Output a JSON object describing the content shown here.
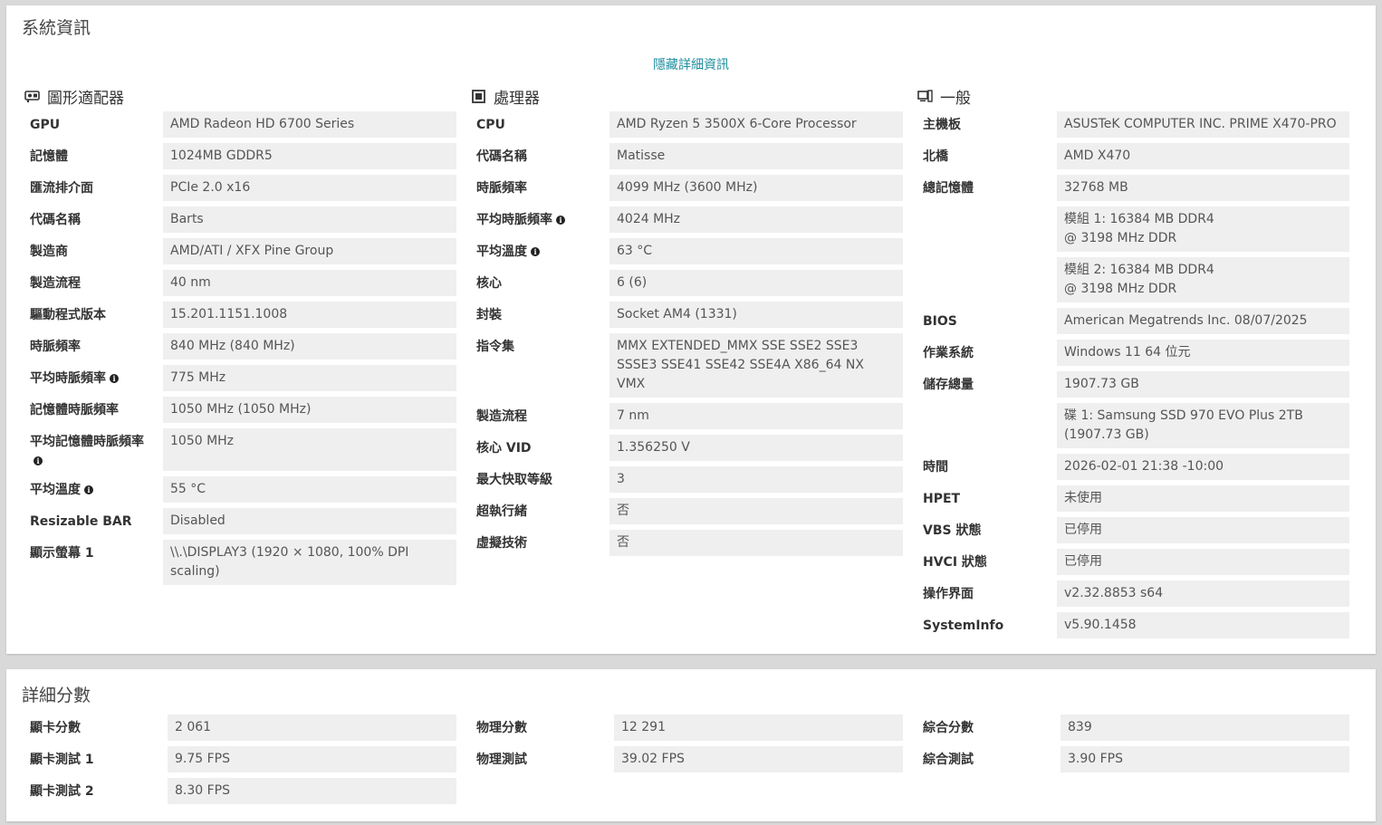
{
  "system_info": {
    "title": "系統資訊",
    "toggle_link": "隱藏詳細資訊",
    "gpu": {
      "heading": "圖形適配器",
      "rows": [
        {
          "label": "GPU",
          "value": "AMD Radeon HD 6700 Series"
        },
        {
          "label": "記憶體",
          "value": "1024MB GDDR5"
        },
        {
          "label": "匯流排介面",
          "value": "PCIe 2.0 x16"
        },
        {
          "label": "代碼名稱",
          "value": "Barts"
        },
        {
          "label": "製造商",
          "value": "AMD/ATI / XFX Pine Group"
        },
        {
          "label": "製造流程",
          "value": "40 nm"
        },
        {
          "label": "驅動程式版本",
          "value": "15.201.1151.1008"
        },
        {
          "label": "時脈頻率",
          "value": "840 MHz (840 MHz)"
        },
        {
          "label": "平均時脈頻率",
          "value": "775 MHz"
        },
        {
          "label": "記憶體時脈頻率",
          "value": "1050 MHz (1050 MHz)"
        },
        {
          "label": "平均記憶體時脈頻率",
          "value": "1050 MHz"
        },
        {
          "label": "平均溫度",
          "value": "55 °C"
        },
        {
          "label": "Resizable BAR",
          "value": "Disabled"
        },
        {
          "label": "顯示螢幕 1",
          "value": "\\\\.\\DISPLAY3 (1920 × 1080, 100% DPI scaling)"
        }
      ]
    },
    "cpu": {
      "heading": "處理器",
      "rows": [
        {
          "label": "CPU",
          "value": "AMD Ryzen 5 3500X 6-Core Processor"
        },
        {
          "label": "代碼名稱",
          "value": "Matisse"
        },
        {
          "label": "時脈頻率",
          "value": "4099 MHz (3600 MHz)"
        },
        {
          "label": "平均時脈頻率",
          "value": "4024 MHz"
        },
        {
          "label": "平均溫度",
          "value": "63 °C"
        },
        {
          "label": "核心",
          "value": "6 (6)"
        },
        {
          "label": "封裝",
          "value": "Socket AM4 (1331)"
        },
        {
          "label": "指令集",
          "value": "MMX EXTENDED_MMX SSE SSE2 SSE3 SSSE3 SSE41 SSE42 SSE4A X86_64 NX VMX"
        },
        {
          "label": "製造流程",
          "value": "7 nm"
        },
        {
          "label": "核心 VID",
          "value": "1.356250 V"
        },
        {
          "label": "最大快取等級",
          "value": "3"
        },
        {
          "label": "超執行緒",
          "value": "否"
        },
        {
          "label": "虛擬技術",
          "value": "否"
        }
      ]
    },
    "general": {
      "heading": "一般",
      "rows": [
        {
          "label": "主機板",
          "value": "ASUSTeK COMPUTER INC. PRIME X470-PRO"
        },
        {
          "label": "北橋",
          "value": "AMD X470"
        },
        {
          "label": "總記憶體",
          "value": "32768 MB"
        },
        {
          "label": "",
          "value": "模組 1: 16384 MB DDR4 @ 3198 MHz DDR"
        },
        {
          "label": "",
          "value": "模組 2: 16384 MB DDR4 @ 3198 MHz DDR"
        },
        {
          "label": "BIOS",
          "value": "American Megatrends Inc. 08/07/2025"
        },
        {
          "label": "作業系統",
          "value": "Windows 11 64 位元"
        },
        {
          "label": "儲存總量",
          "value": "1907.73 GB"
        },
        {
          "label": "",
          "value": "碟 1: Samsung SSD 970 EVO Plus 2TB (1907.73 GB)"
        },
        {
          "label": "時間",
          "value": "2026-02-01 21:38 -10:00"
        },
        {
          "label": "HPET",
          "value": "未使用"
        },
        {
          "label": "VBS 狀態",
          "value": "已停用"
        },
        {
          "label": "HVCI 狀態",
          "value": "已停用"
        },
        {
          "label": "操作界面",
          "value": "v2.32.8853 s64"
        },
        {
          "label": "SystemInfo",
          "value": "v5.90.1458"
        }
      ]
    }
  },
  "detailed_scores": {
    "title": "詳細分數",
    "graphics": [
      {
        "label": "顯卡分數",
        "value": "2 061"
      },
      {
        "label": "顯卡測試 1",
        "value": "9.75 FPS"
      },
      {
        "label": "顯卡測試 2",
        "value": "8.30 FPS"
      }
    ],
    "physics": [
      {
        "label": "物理分數",
        "value": "12 291"
      },
      {
        "label": "物理測試",
        "value": "39.02 FPS"
      }
    ],
    "combined": [
      {
        "label": "綜合分數",
        "value": "839"
      },
      {
        "label": "綜合測試",
        "value": "3.90 FPS"
      }
    ]
  }
}
